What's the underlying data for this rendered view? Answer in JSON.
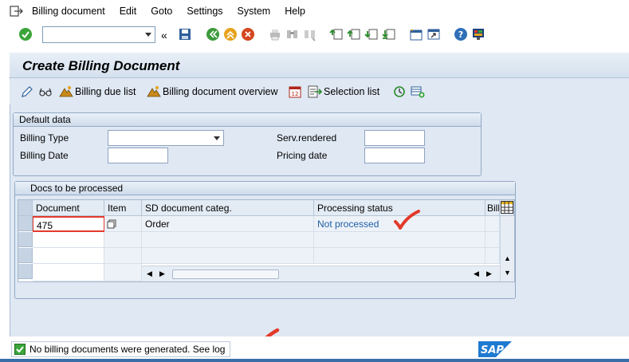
{
  "menubar": {
    "items": [
      {
        "label": "Billing document"
      },
      {
        "label": "Edit"
      },
      {
        "label": "Goto"
      },
      {
        "label": "Settings"
      },
      {
        "label": "System"
      },
      {
        "label": "Help"
      }
    ]
  },
  "toolbar": {
    "command_value": ""
  },
  "screen": {
    "title": "Create Billing Document"
  },
  "app_toolbar": {
    "billing_due_list": "Billing due list",
    "billing_doc_overview": "Billing document overview",
    "selection_list": "Selection list"
  },
  "default_data": {
    "title": "Default data",
    "billing_type_label": "Billing Type",
    "billing_type_value": "",
    "billing_date_label": "Billing Date",
    "billing_date_value": "",
    "serv_rendered_label": "Serv.rendered",
    "serv_rendered_value": "",
    "pricing_date_label": "Pricing date",
    "pricing_date_value": ""
  },
  "docs": {
    "title": "Docs to be processed",
    "columns": [
      "Document",
      "Item",
      "SD document categ.",
      "Processing status",
      "Billi"
    ],
    "rows": [
      {
        "document": "475",
        "item": "",
        "categ": "Order",
        "status": "Not processed"
      }
    ]
  },
  "status": {
    "message": "No billing documents were generated. See log"
  },
  "colors": {
    "accent": "#3a6ea8",
    "status_link": "#1f5fa6",
    "check_red": "#e23a2b"
  }
}
